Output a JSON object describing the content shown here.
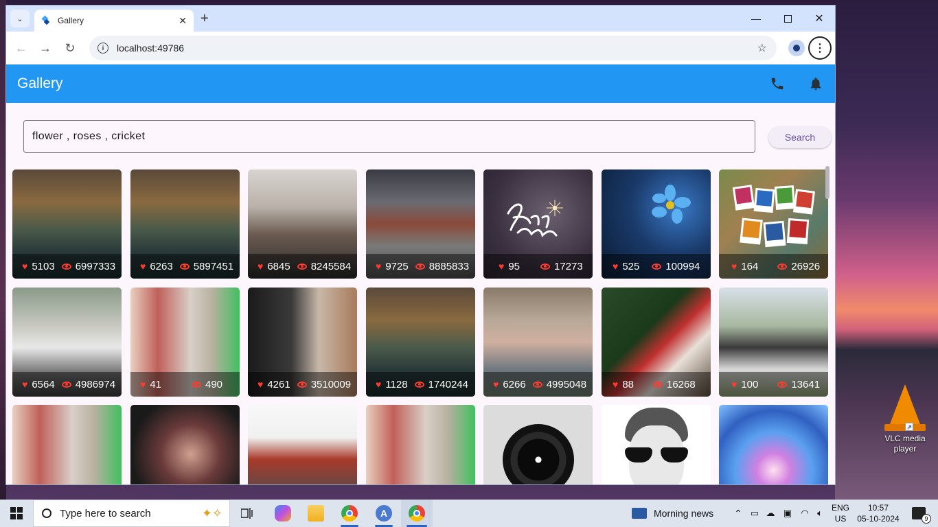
{
  "browser": {
    "tab_title": "Gallery",
    "url": "localhost:49786",
    "new_tab_glyph": "+",
    "close_glyph": "✕"
  },
  "app": {
    "title": "Gallery",
    "actions": [
      "phone-icon",
      "bell-icon"
    ],
    "accent": "#2196f3"
  },
  "search": {
    "value": "flower , roses , cricket",
    "button_label": "Search"
  },
  "gallery": {
    "row1": [
      {
        "likes": "5103",
        "views": "6997333",
        "subject": "lake-island-trees-storm"
      },
      {
        "likes": "6263",
        "views": "5897451",
        "subject": "lake-island-trees-storm"
      },
      {
        "likes": "6845",
        "views": "8245584",
        "subject": "group-selfie-camera"
      },
      {
        "likes": "9725",
        "views": "8885833",
        "subject": "city-buildings-bridge"
      },
      {
        "likes": "95",
        "views": "17273",
        "subject": "luz-e-vida-logo"
      },
      {
        "likes": "525",
        "views": "100994",
        "subject": "blue-flower"
      },
      {
        "likes": "164",
        "views": "26926",
        "subject": "time-out-photos"
      }
    ],
    "row2": [
      {
        "likes": "6564",
        "views": "4986974",
        "subject": "man-sprint-start"
      },
      {
        "likes": "41",
        "views": "490",
        "subject": "white-horse-child"
      },
      {
        "likes": "4261",
        "views": "3510009",
        "subject": "photographer-city"
      },
      {
        "likes": "1128",
        "views": "1740244",
        "subject": "lake-island-trees-storm"
      },
      {
        "likes": "6266",
        "views": "4995048",
        "subject": "bald-man-glasses"
      },
      {
        "likes": "88",
        "views": "16268",
        "subject": "girl-with-flowers"
      },
      {
        "likes": "100",
        "views": "13641",
        "subject": "man-bandana"
      }
    ],
    "row3": [
      {
        "subject": "white-horse-child"
      },
      {
        "subject": "woman-red-hair"
      },
      {
        "subject": "kremlin-selfie"
      },
      {
        "subject": "white-horse-child"
      },
      {
        "subject": "camera-lens"
      },
      {
        "subject": "man-sunglasses"
      },
      {
        "subject": "neon-ferris-wheel"
      }
    ]
  },
  "desktop": {
    "vlc_label": "VLC media player"
  },
  "taskbar": {
    "search_placeholder": "Type here to search",
    "news_label": "Morning news",
    "lang_top": "ENG",
    "lang_bottom": "US",
    "time": "10:57",
    "date": "05-10-2024",
    "notification_count": "9"
  }
}
